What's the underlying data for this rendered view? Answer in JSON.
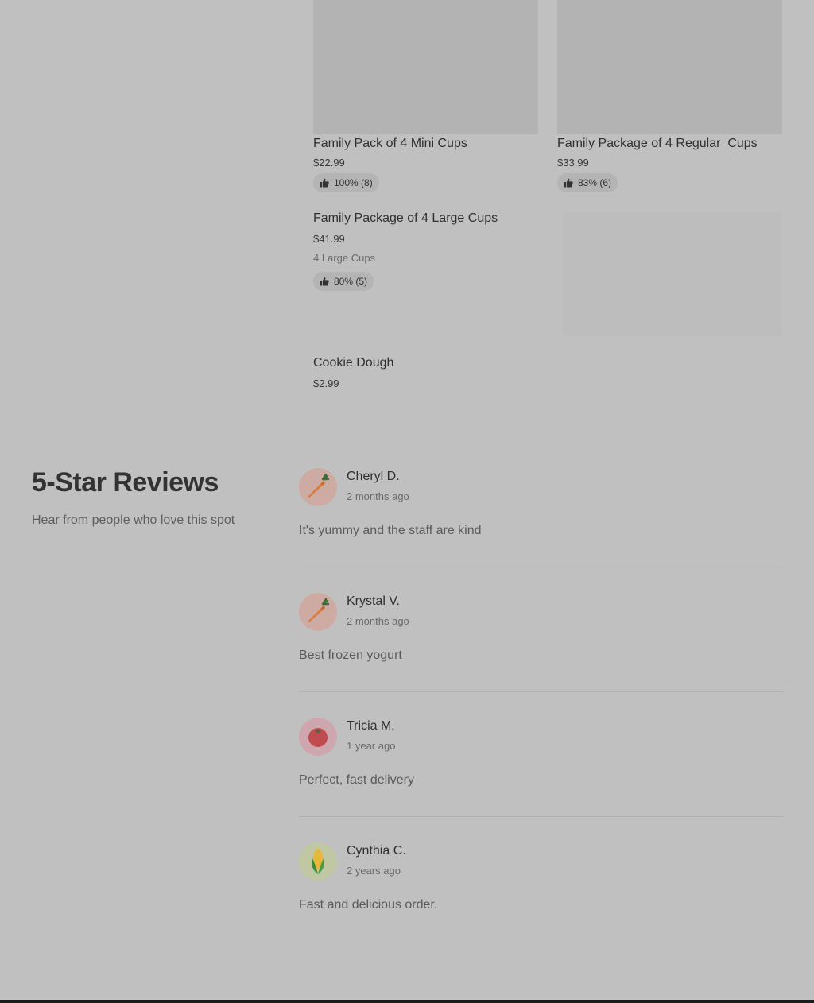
{
  "products": [
    {
      "name": "Family Pack of 4 Mini Cups",
      "price": "$22.99",
      "rating": "100% (8)"
    },
    {
      "name": "Family Package of 4 Regular  Cups",
      "price": "$33.99",
      "rating": "83% (6)"
    },
    {
      "name": "Family Package of 4 Large Cups",
      "price": "$41.99",
      "description": "4 Large Cups",
      "rating": "80% (5)"
    },
    {
      "name": "Cookie Dough",
      "price": "$2.99"
    }
  ],
  "reviews_section": {
    "title": "5-Star Reviews",
    "subtitle": "Hear from people who love this spot"
  },
  "reviews": [
    {
      "name": "Cheryl D.",
      "date": "2 months ago",
      "text": "It's yummy and the staff are kind",
      "avatar_icon": "carrot-icon"
    },
    {
      "name": "Krystal V.",
      "date": "2 months ago",
      "text": "Best frozen yogurt",
      "avatar_icon": "carrot-icon"
    },
    {
      "name": "Tricia M.",
      "date": "1 year ago",
      "text": "Perfect, fast delivery",
      "avatar_icon": "tomato-icon"
    },
    {
      "name": "Cynthia C.",
      "date": "2 years ago",
      "text": "Fast and delicious order.",
      "avatar_icon": "corn-icon"
    }
  ],
  "colors": {
    "background": "#c0c0c0",
    "image_placeholder": "#b3b3b3",
    "carrot_avatar_bg": "#cdaaa2",
    "tomato_avatar_bg": "#cea6ad",
    "corn_avatar_bg": "#bfc8a3"
  }
}
